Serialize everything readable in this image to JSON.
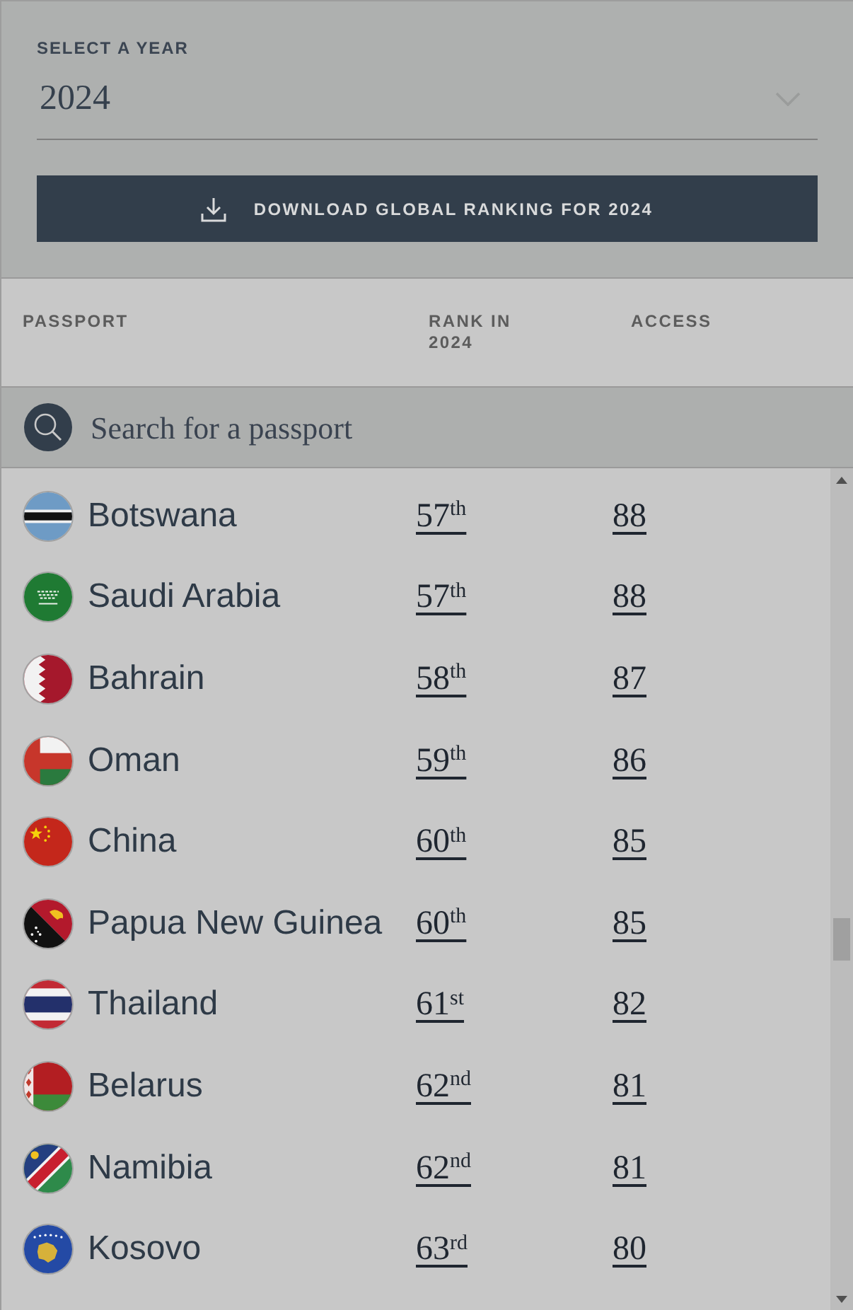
{
  "year_select": {
    "label": "SELECT A YEAR",
    "value": "2024"
  },
  "download_button": {
    "label": "DOWNLOAD GLOBAL RANKING FOR 2024"
  },
  "table": {
    "columns": [
      "PASSPORT",
      "RANK IN 2024",
      "ACCESS"
    ],
    "search": {
      "placeholder": "Search for a passport"
    },
    "rows": [
      {
        "country": "Botswana",
        "rank": "57$^{th}$",
        "access": "88"
      },
      {
        "country": "Saudi Arabia",
        "rank": "57$^{th}$",
        "access": "88"
      },
      {
        "country": "Bahrain",
        "rank": "58$^{th}$",
        "access": "87"
      },
      {
        "country": "Oman",
        "rank": "59$^{th}$",
        "access": "86"
      },
      {
        "country": "China",
        "rank": "60$^{th}$",
        "access": "85"
      },
      {
        "country": "Papua New Guinea",
        "rank": "60$^{th}$",
        "access": "85"
      },
      {
        "country": "Thailand",
        "rank": "61$^{st}$",
        "access": "82"
      },
      {
        "country": "Belarus",
        "rank": "62$^{nd}$",
        "access": "81"
      },
      {
        "country": "Namibia",
        "rank": "62$^{nd}$",
        "access": "81"
      },
      {
        "country": "Kosovo",
        "rank": "63$^{rd}$",
        "access": "80"
      }
    ]
  }
}
